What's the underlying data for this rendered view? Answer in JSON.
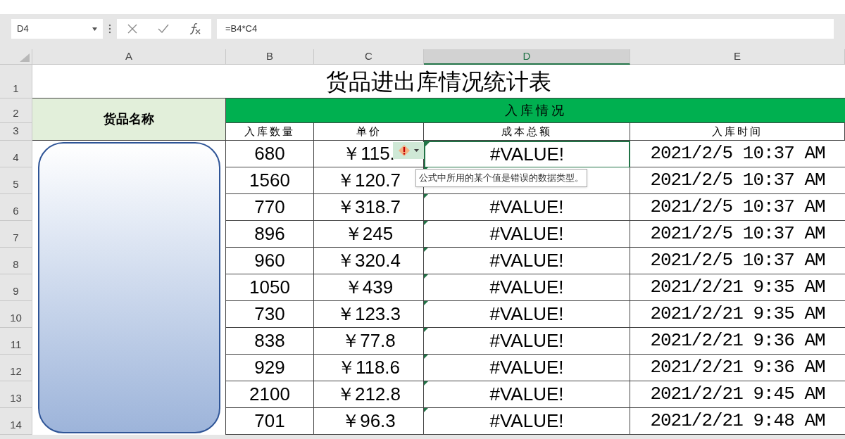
{
  "formula_bar": {
    "name_box": "D4",
    "formula": "=B4*C4"
  },
  "columns": [
    {
      "label": "A",
      "selected": false
    },
    {
      "label": "B",
      "selected": false
    },
    {
      "label": "C",
      "selected": false
    },
    {
      "label": "D",
      "selected": true
    },
    {
      "label": "E",
      "selected": false
    }
  ],
  "row_numbers": [
    "1",
    "2",
    "3",
    "4",
    "5",
    "6",
    "7",
    "8",
    "9",
    "10",
    "11",
    "12",
    "13",
    "14"
  ],
  "title": "货品进出库情况统计表",
  "name_header": "货品名称",
  "group_header": "入库情况",
  "sub_headers": [
    "入库数量",
    "单价",
    "成本总额",
    "入库时间"
  ],
  "rows": [
    {
      "qty": "680",
      "price": "￥115.",
      "cost": "#VALUE!",
      "time": "2021/2/5 10:37 AM",
      "flagged": true,
      "selected": true
    },
    {
      "qty": "1560",
      "price": "￥120.7",
      "time": "2021/2/5 10:37 AM",
      "flagged": true,
      "selected": false
    },
    {
      "qty": "770",
      "price": "￥318.7",
      "cost": "#VALUE!",
      "time": "2021/2/5 10:37 AM",
      "flagged": true,
      "selected": false
    },
    {
      "qty": "896",
      "price": "￥245",
      "cost": "#VALUE!",
      "time": "2021/2/5 10:37 AM",
      "flagged": true,
      "selected": false
    },
    {
      "qty": "960",
      "price": "￥320.4",
      "cost": "#VALUE!",
      "time": "2021/2/5 10:37 AM",
      "flagged": true,
      "selected": false
    },
    {
      "qty": "1050",
      "price": "￥439",
      "cost": "#VALUE!",
      "time": "2021/2/21 9:35 AM",
      "flagged": true,
      "selected": false
    },
    {
      "qty": "730",
      "price": "￥123.3",
      "cost": "#VALUE!",
      "time": "2021/2/21 9:35 AM",
      "flagged": true,
      "selected": false
    },
    {
      "qty": "838",
      "price": "￥77.8",
      "cost": "#VALUE!",
      "time": "2021/2/21 9:36 AM",
      "flagged": true,
      "selected": false
    },
    {
      "qty": "929",
      "price": "￥118.6",
      "cost": "#VALUE!",
      "time": "2021/2/21 9:36 AM",
      "flagged": true,
      "selected": false
    },
    {
      "qty": "2100",
      "price": "￥212.8",
      "cost": "#VALUE!",
      "time": "2021/2/21 9:45 AM",
      "flagged": true,
      "selected": false
    },
    {
      "qty": "701",
      "price": "￥96.3",
      "cost": "#VALUE!",
      "time": "2021/2/21 9:48 AM",
      "flagged": true,
      "selected": false
    }
  ],
  "error_tooltip": "公式中所用的某个值是错误的数据类型。"
}
